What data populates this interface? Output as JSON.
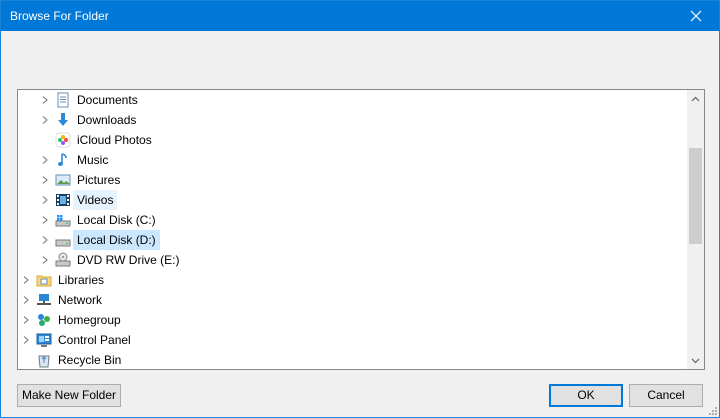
{
  "window": {
    "title": "Browse For Folder"
  },
  "tree": {
    "items": [
      {
        "label": "Documents",
        "icon": "documents-icon",
        "level": 1,
        "expandable": true,
        "state": "normal"
      },
      {
        "label": "Downloads",
        "icon": "downloads-icon",
        "level": 1,
        "expandable": true,
        "state": "normal"
      },
      {
        "label": "iCloud Photos",
        "icon": "icloud-photos-icon",
        "level": 1,
        "expandable": false,
        "state": "normal"
      },
      {
        "label": "Music",
        "icon": "music-icon",
        "level": 1,
        "expandable": true,
        "state": "normal"
      },
      {
        "label": "Pictures",
        "icon": "pictures-icon",
        "level": 1,
        "expandable": true,
        "state": "normal"
      },
      {
        "label": "Videos",
        "icon": "videos-icon",
        "level": 1,
        "expandable": true,
        "state": "hover"
      },
      {
        "label": "Local Disk (C:)",
        "icon": "windows-drive-icon",
        "level": 1,
        "expandable": true,
        "state": "normal"
      },
      {
        "label": "Local Disk (D:)",
        "icon": "drive-icon",
        "level": 1,
        "expandable": true,
        "state": "selected"
      },
      {
        "label": "DVD RW Drive (E:)",
        "icon": "dvd-drive-icon",
        "level": 1,
        "expandable": true,
        "state": "normal"
      },
      {
        "label": "Libraries",
        "icon": "libraries-icon",
        "level": 0,
        "expandable": true,
        "state": "normal"
      },
      {
        "label": "Network",
        "icon": "network-icon",
        "level": 0,
        "expandable": true,
        "state": "normal"
      },
      {
        "label": "Homegroup",
        "icon": "homegroup-icon",
        "level": 0,
        "expandable": true,
        "state": "normal"
      },
      {
        "label": "Control Panel",
        "icon": "control-panel-icon",
        "level": 0,
        "expandable": true,
        "state": "normal"
      },
      {
        "label": "Recycle Bin",
        "icon": "recycle-bin-icon",
        "level": 0,
        "expandable": false,
        "state": "normal"
      }
    ]
  },
  "buttons": {
    "make_new_folder": "Make New Folder",
    "ok": "OK",
    "cancel": "Cancel"
  },
  "colors": {
    "titlebar": "#0078d7",
    "hover": "#e5f3ff",
    "selected": "#cce8ff"
  }
}
